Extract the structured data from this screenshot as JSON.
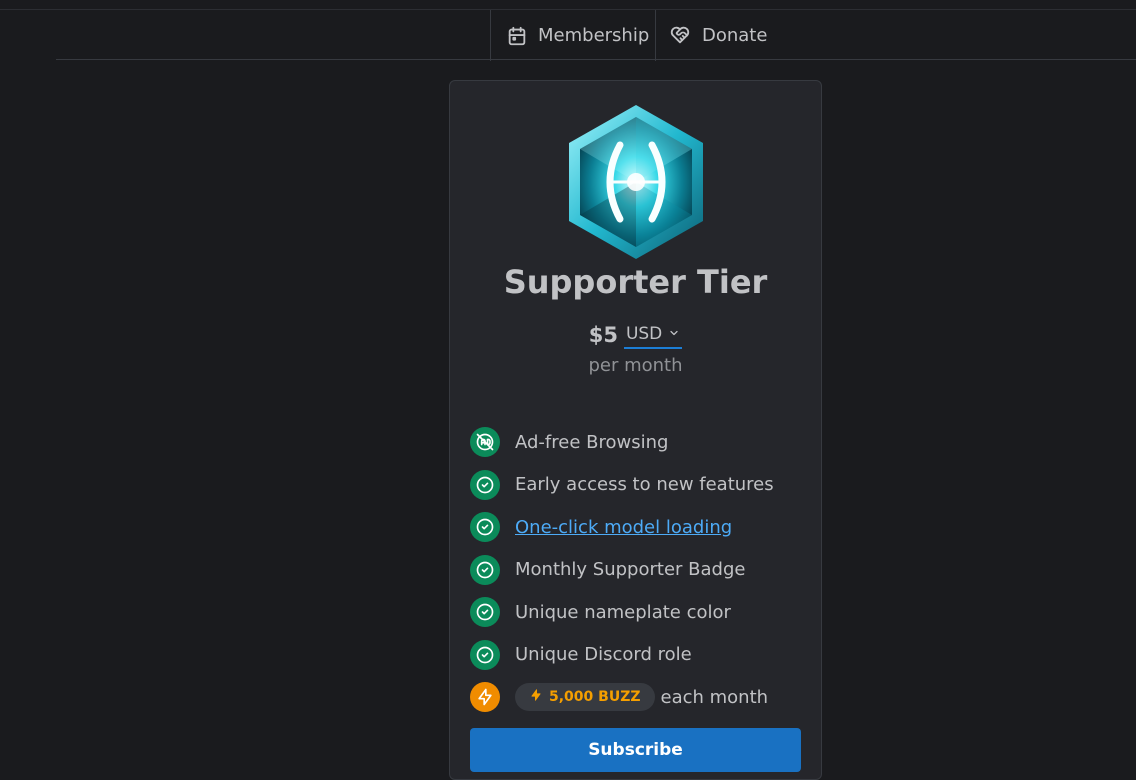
{
  "tabs": [
    {
      "label": "Membership",
      "icon": "calendar-icon",
      "active": true
    },
    {
      "label": "Donate",
      "icon": "heart-handshake-icon",
      "active": false
    }
  ],
  "tier": {
    "name": "Supporter Tier",
    "price": "$5",
    "currency": "USD",
    "period": "per month",
    "badge_icon": "blue-crystal-hexagon-gem",
    "benefits": [
      {
        "text": "Ad-free Browsing",
        "icon": "ad-off-icon"
      },
      {
        "text": "Early access to new features",
        "icon": "circle-check-icon"
      },
      {
        "text": "One-click model loading",
        "icon": "circle-check-icon",
        "link": true
      },
      {
        "text": "Monthly Supporter Badge",
        "icon": "circle-check-icon"
      },
      {
        "text": "Unique nameplate color",
        "icon": "circle-check-icon"
      },
      {
        "text": "Unique Discord role",
        "icon": "circle-check-icon"
      }
    ],
    "buzz": {
      "amount": "5,000 BUZZ",
      "suffix": "each month",
      "icon": "bolt-icon"
    },
    "subscribe_label": "Subscribe"
  },
  "colors": {
    "background": "#1a1b1e",
    "card": "#25262b",
    "check_green": "#0b8b5a",
    "buzz_orange": "#f08c00",
    "button_blue": "#1971c2",
    "link_blue": "#4dabf7"
  }
}
